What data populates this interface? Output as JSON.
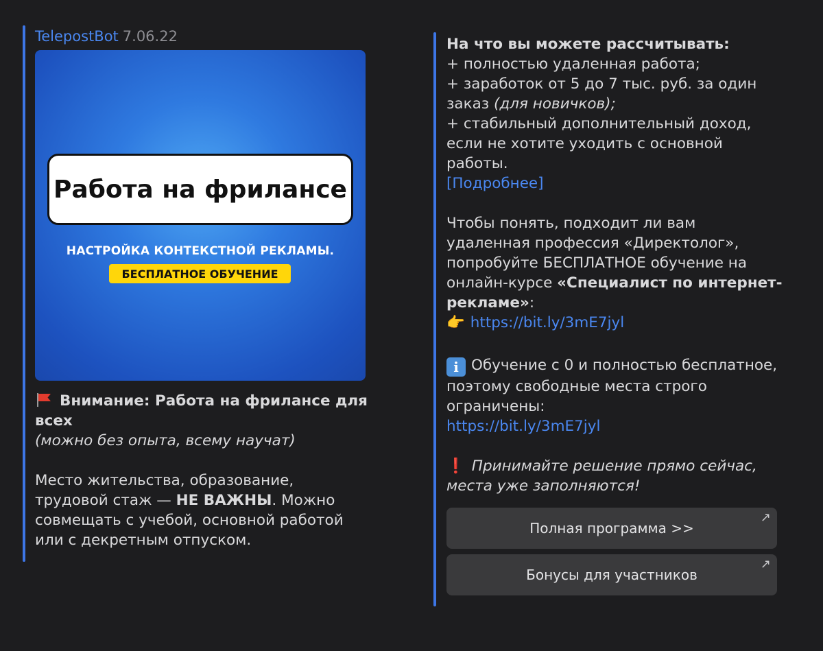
{
  "post_left": {
    "sender": "TelepostBot",
    "date": "7.06.22",
    "banner": {
      "title": "Работа на фрилансе",
      "subtitle": "НАСТРОЙКА КОНТЕКСТНОЙ РЕКЛАМЫ.",
      "badge": "БЕСПЛАТНОЕ ОБУЧЕНИЕ"
    },
    "headline": "Внимание: Работа на фрилансе для всех",
    "headline_note": "(можно без опыта, всему научат)",
    "paragraph_start": "Место жительства, образование, трудовой стаж — ",
    "paragraph_bold": "НЕ ВАЖНЫ",
    "paragraph_end": ". Можно совмещать с учебой, основной работой или с декретным отпуском."
  },
  "post_right": {
    "benefits_title": "На что вы можете рассчитывать:",
    "benefit_1": "+ полностью удаленная работа;",
    "benefit_2": "+ заработок от 5 до 7 тыс. руб. за один заказ ",
    "benefit_2_note": "(для новичков);",
    "benefit_3": "+ стабильный дополнительный доход, если не хотите уходить с основной работы.",
    "more_link": "[Подробнее]",
    "course_text": "Чтобы понять, подходит ли вам удаленная профессия «Директолог», попробуйте БЕСПЛАТНОЕ обучение на онлайн-курсе ",
    "course_name": "«Специалист по интернет-рекламе»",
    "course_colon": ":",
    "hand_emoji": "👉",
    "link_1": "https://bit.ly/3mE7jyl",
    "info_icon": "i",
    "info_text": "Обучение с 0 и полностью бесплатное, поэтому свободные места строго ограничены:",
    "link_2": "https://bit.ly/3mE7jyl",
    "excl_icon": "❗",
    "urgent_text": "Принимайте решение прямо сейчас, места уже заполняются!"
  },
  "buttons": {
    "program": "Полная программа >>",
    "bonuses": "Бонусы для участников",
    "arrow_icon": "↗"
  },
  "colors": {
    "background": "#1d1d1f",
    "accent": "#3d76e6",
    "link": "#4a87f0",
    "badge": "#ffd60a"
  }
}
